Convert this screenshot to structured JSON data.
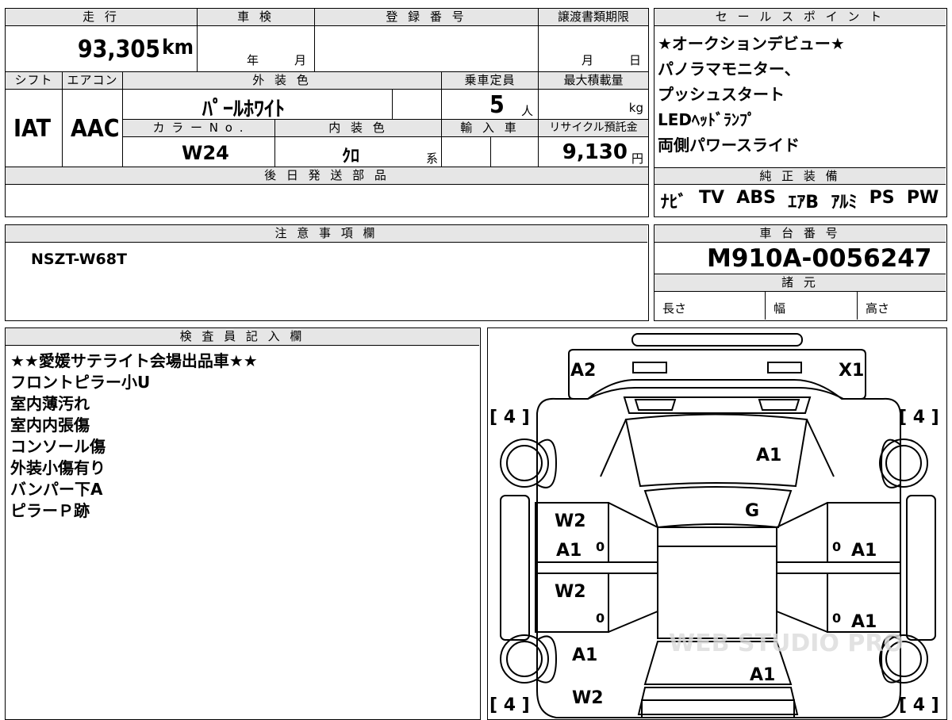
{
  "spec": {
    "mileage_header": "走 行",
    "mileage_value": "93,305",
    "mileage_unit": "km",
    "shaken_header": "車 検",
    "shaken_year_label": "年",
    "shaken_month_label": "月",
    "registration_header": "登 録 番 号",
    "transfer_deadline_header": "譲渡書類期限",
    "transfer_month_label": "月",
    "transfer_day_label": "日",
    "shift_header": "シフト",
    "shift_value": "IAT",
    "aircon_header": "エアコン",
    "aircon_value": "AAC",
    "exterior_color_header": "外 装 色",
    "exterior_color_value": "ﾊﾟｰﾙﾎﾜｲﾄ",
    "capacity_header": "乗車定員",
    "capacity_value": "5",
    "capacity_unit": "人",
    "max_load_header": "最大積載量",
    "max_load_unit": "kg",
    "color_no_header": "カ ラ ー N o .",
    "color_no_value": "W24",
    "interior_color_header": "内 装 色",
    "interior_color_value": "ｸﾛ",
    "interior_color_suffix": "系",
    "import_header": "輸 入 車",
    "recycle_header": "リサイクル預託金",
    "recycle_value": "9,130",
    "recycle_unit": "円",
    "later_parts_header": "後 日 発 送 部 品"
  },
  "sales_points": {
    "header": "セ ー ル ス ポ イ ン ト",
    "items": [
      "★オークションデビュー★",
      "パノラマモニター、",
      "プッシュスタート",
      "LEDﾍｯﾄﾞﾗﾝﾌﾟ",
      "両側パワースライド"
    ]
  },
  "genuine_equipment": {
    "header": "純 正 装 備",
    "items": [
      "ﾅﾋﾞ",
      "TV",
      "ABS",
      "ｴｱB",
      "ｱﾙﾐ",
      "PS",
      "PW"
    ]
  },
  "notes": {
    "header": "注 意 事 項 欄",
    "text": "NSZT-W68T"
  },
  "chassis": {
    "header": "車 台 番 号",
    "number": "M910A-0056247",
    "specs_header": "諸 元",
    "length_label": "長さ",
    "width_label": "幅",
    "height_label": "高さ"
  },
  "inspector": {
    "header": "検 査 員 記 入 欄",
    "lines": [
      "★★愛媛サテライト会場出品車★★",
      "フロントピラー小U",
      "室内薄汚れ",
      "室内内張傷",
      "コンソール傷",
      "外装小傷有り",
      "バンパー下A",
      "ピラーＰ跡"
    ]
  },
  "diagram": {
    "tire_tread": [
      "[ 4 ]",
      "[ 4 ]",
      "[ 4 ]",
      "[ 4 ]"
    ],
    "marks": {
      "front_left": "A2",
      "front_right": "X1",
      "hood": "A1",
      "windshield": "G",
      "left_front_door_1": "W2",
      "left_front_door_2": "A1",
      "left_front_door_zero": "0",
      "left_rear_door": "W2",
      "left_rear_door_zero": "0",
      "right_front_door_zero": "0",
      "right_front_door": "A1",
      "right_rear_door_zero": "0",
      "right_rear_door": "A1",
      "left_rear_quarter": "A1",
      "rear_left_lower": "W2",
      "roof_rear": "A1"
    },
    "watermark": "WEB STUDIO PRO"
  }
}
